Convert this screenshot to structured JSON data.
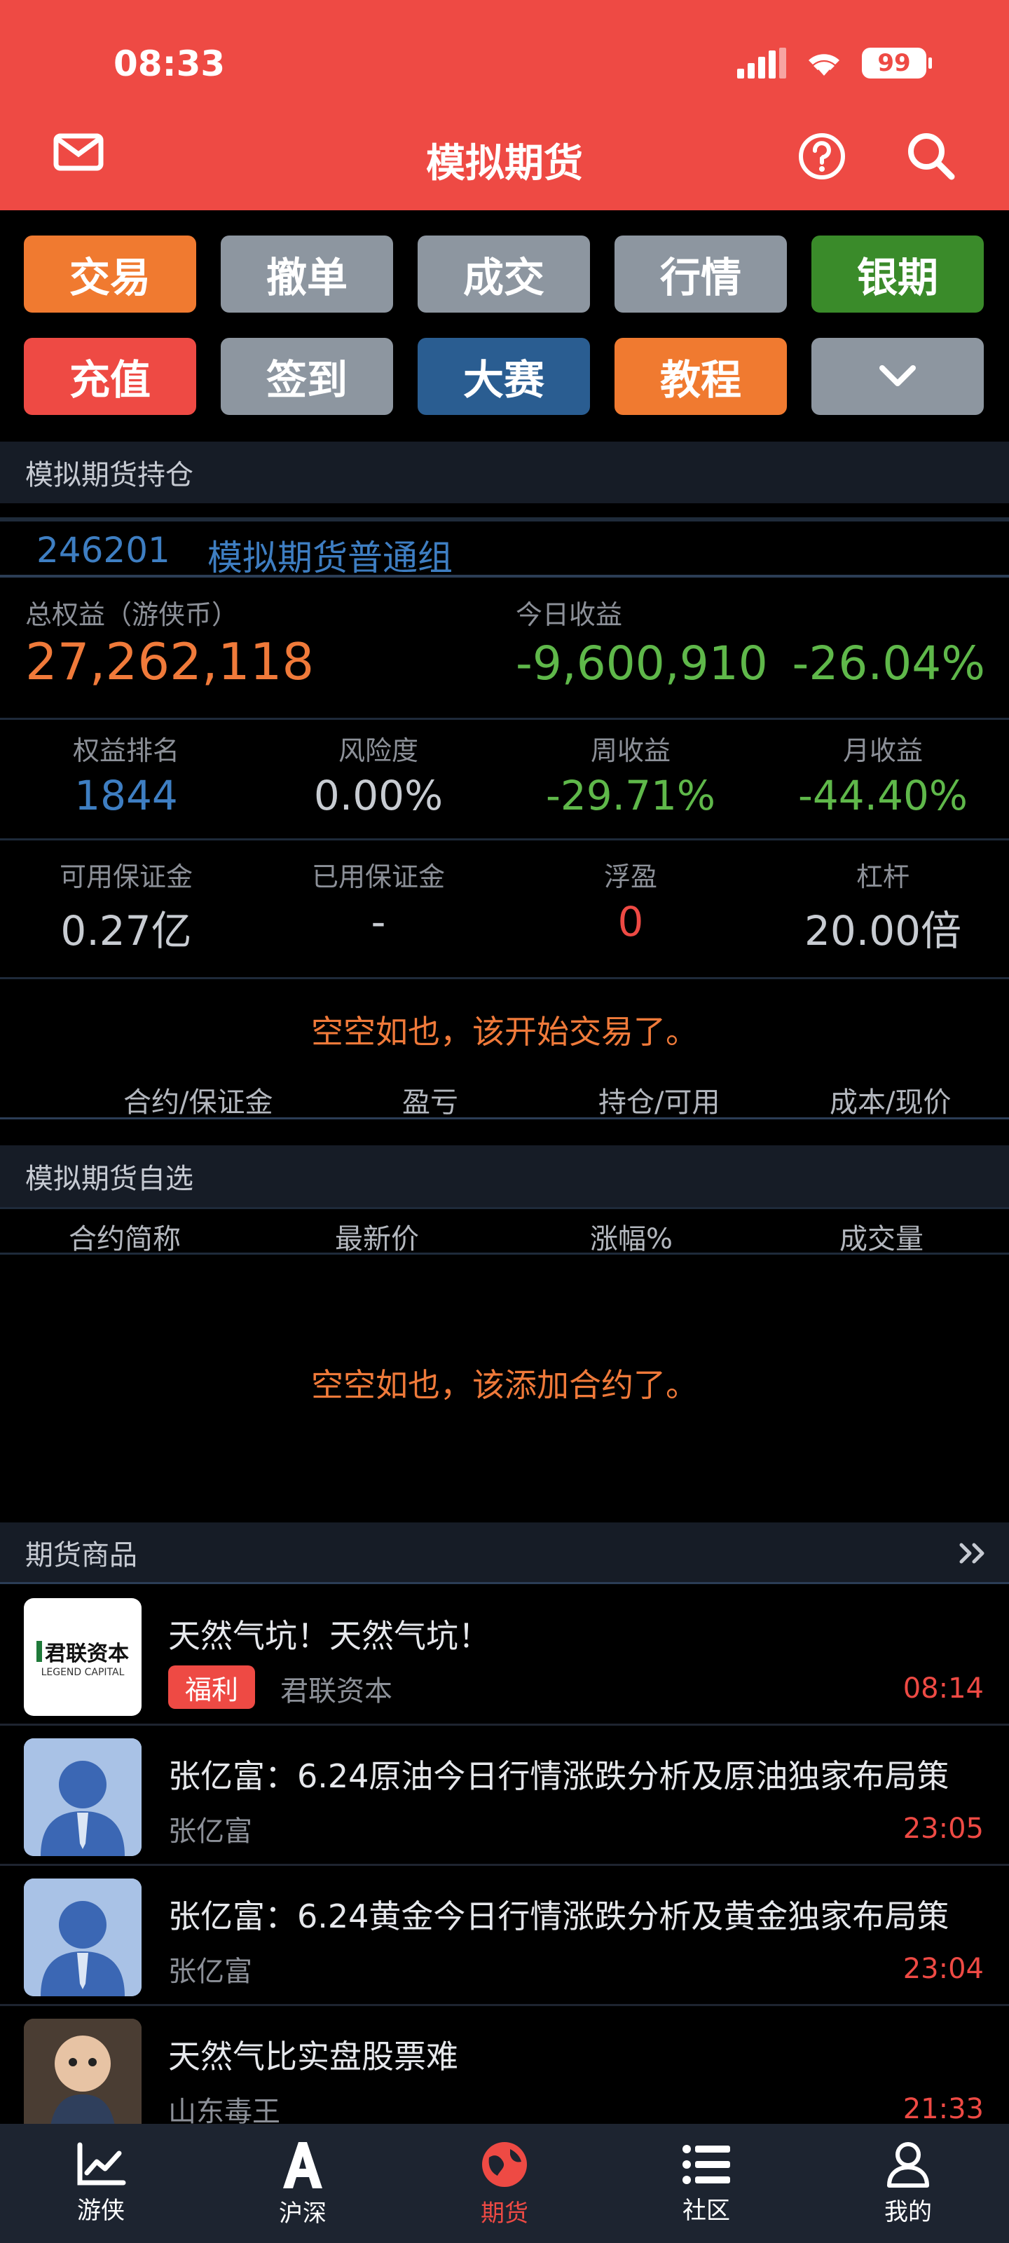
{
  "status": {
    "time": "08:33",
    "battery": "99"
  },
  "header": {
    "title": "模拟期货"
  },
  "grid_buttons": [
    {
      "label": "交易",
      "color": "#f07a30"
    },
    {
      "label": "撤单",
      "color": "#8d96a0"
    },
    {
      "label": "成交",
      "color": "#8d96a0"
    },
    {
      "label": "行情",
      "color": "#8d96a0"
    },
    {
      "label": "银期",
      "color": "#3a8b2a"
    },
    {
      "label": "充值",
      "color": "#ee4a44"
    },
    {
      "label": "签到",
      "color": "#8d96a0"
    },
    {
      "label": "大赛",
      "color": "#2a5d91"
    },
    {
      "label": "教程",
      "color": "#f07a30"
    }
  ],
  "positions": {
    "section_title": "模拟期货持仓",
    "group_id": "246201",
    "group_name": "模拟期货普通组",
    "total_equity_label": "总权益（游侠币）",
    "total_equity": "27,262,118",
    "today_profit_label": "今日收益",
    "today_profit": "-9,600,910",
    "today_profit_pct": "-26.04%",
    "stats_row1": [
      {
        "label": "权益排名",
        "value": "1844",
        "color": "#3e7ec2"
      },
      {
        "label": "风险度",
        "value": "0.00%",
        "color": "#c8ccd2"
      },
      {
        "label": "周收益",
        "value": "-29.71%",
        "color": "#5fb84a"
      },
      {
        "label": "月收益",
        "value": "-44.40%",
        "color": "#5fb84a"
      }
    ],
    "stats_row2": [
      {
        "label": "可用保证金",
        "value": "0.27亿",
        "color": "#c8ccd2"
      },
      {
        "label": "已用保证金",
        "value": "-",
        "color": "#c8ccd2"
      },
      {
        "label": "浮盈",
        "value": "0",
        "color": "#ee4a44"
      },
      {
        "label": "杠杆",
        "value": "20.00倍",
        "color": "#c8ccd2"
      }
    ],
    "empty_message": "空空如也，该开始交易了。",
    "columns": [
      "合约/保证金",
      "盈亏",
      "持仓/可用",
      "成本/现价"
    ]
  },
  "watchlist": {
    "section_title": "模拟期货自选",
    "columns": [
      "合约简称",
      "最新价",
      "涨幅%",
      "成交量"
    ],
    "empty_message": "空空如也，该添加合约了。"
  },
  "news": {
    "section_title": "期货商品",
    "items": [
      {
        "title": "天然气坑！天然气坑！",
        "badge": "福利",
        "source": "君联资本",
        "time": "08:14",
        "logo_text": "君联资本",
        "logo_sub": "LEGEND CAPITAL"
      },
      {
        "title": "张亿富：6.24原油今日行情涨跌分析及原油独家布局策",
        "source": "张亿富",
        "time": "23:05"
      },
      {
        "title": "张亿富：6.24黄金今日行情涨跌分析及黄金独家布局策",
        "source": "张亿富",
        "time": "23:04"
      },
      {
        "title": "天然气比实盘股票难",
        "source": "山东毒王",
        "time": "21:33"
      }
    ]
  },
  "bottom_nav": [
    {
      "label": "游侠",
      "icon": "chart-trend-icon"
    },
    {
      "label": "沪深",
      "icon": "letter-a-icon"
    },
    {
      "label": "期货",
      "icon": "globe-icon"
    },
    {
      "label": "社区",
      "icon": "list-icon"
    },
    {
      "label": "我的",
      "icon": "person-icon"
    }
  ],
  "colors": {
    "brand_red": "#ee4a44",
    "up": "#ee4a44",
    "down": "#5fb84a",
    "accent_orange": "#f07a3a",
    "link_blue": "#3e7ec2"
  }
}
